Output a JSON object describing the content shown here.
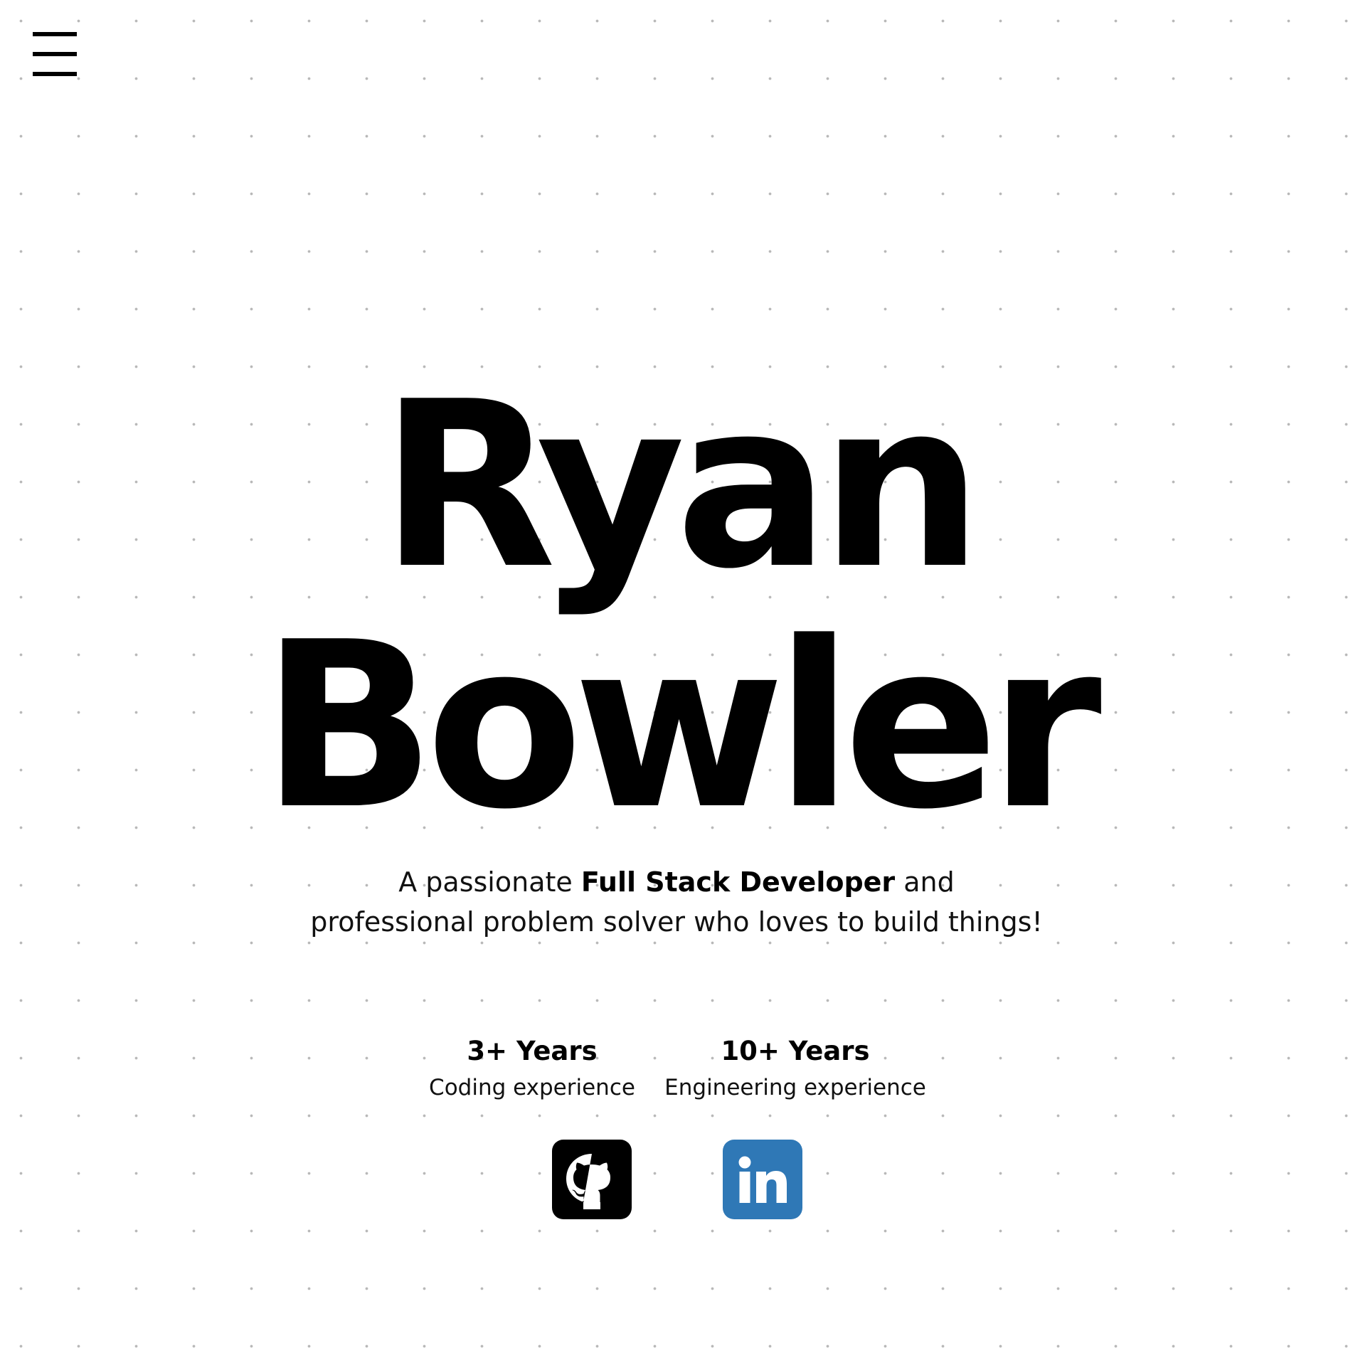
{
  "nav": {
    "menu_icon": "hamburger-menu-icon"
  },
  "hero": {
    "first_name": "Ryan",
    "last_name": "Bowler",
    "tagline": {
      "line1_prefix": "A passionate ",
      "line1_bold": "Full Stack Developer",
      "line1_suffix": " and",
      "line2": "professional problem solver who loves to build things!"
    }
  },
  "stats": [
    {
      "value": "3+ Years",
      "label": "Coding experience"
    },
    {
      "value": "10+ Years",
      "label": "Engineering experience"
    }
  ],
  "social": {
    "github": {
      "icon": "github-icon",
      "color": "#000000"
    },
    "linkedin": {
      "icon": "linkedin-icon",
      "color": "#2f78b6"
    }
  },
  "colors": {
    "background": "#ffffff",
    "dot_grid": "#b8b8b8",
    "text": "#000000"
  }
}
